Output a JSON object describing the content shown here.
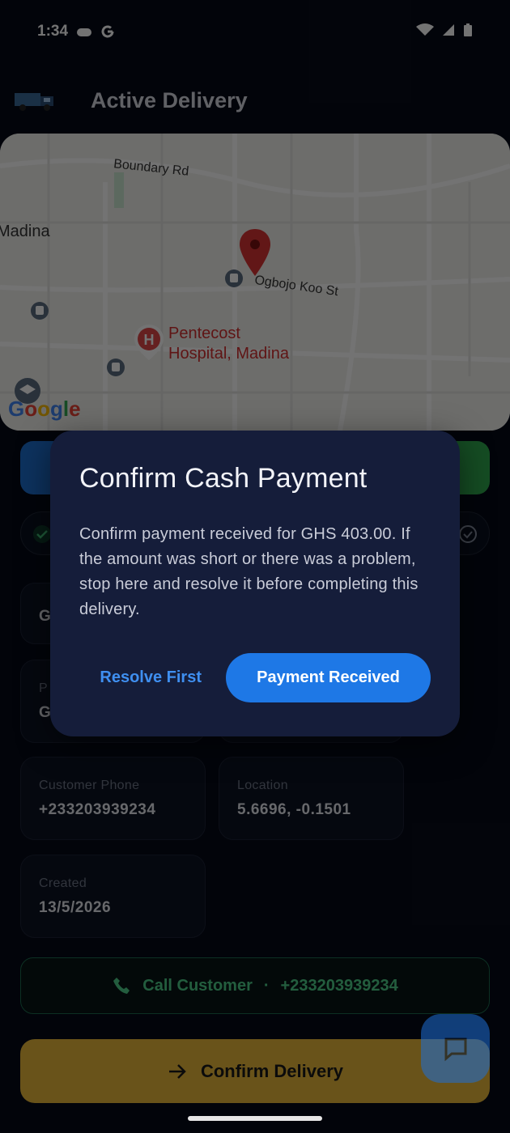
{
  "status_bar": {
    "time": "1:34"
  },
  "app_bar": {
    "title": "Active Delivery"
  },
  "map": {
    "road_boundary": "Boundary Rd",
    "area_madina": "Madina",
    "street_ogbojo": "Ogbojo Koo St",
    "poi_line1": "Pentecost",
    "poi_line2": "Hospital, Madina",
    "google_logo": "Google"
  },
  "cards": {
    "partial1_value": "G",
    "partial2_label": "P",
    "partial2_value": "G",
    "customer_phone_label": "Customer Phone",
    "customer_phone_value": "+233203939234",
    "location_label": "Location",
    "location_value": "5.6696, -0.1501",
    "created_label": "Created",
    "created_value": "13/5/2026"
  },
  "call_button": {
    "label": "Call Customer",
    "separator": "·",
    "phone": "+233203939234"
  },
  "confirm_button": {
    "label": "Confirm Delivery"
  },
  "dialog": {
    "title": "Confirm Cash Payment",
    "body": "Confirm payment received for GHS 403.00. If the amount was short or there was a problem, stop here and resolve it before completing this delivery.",
    "secondary_action": "Resolve First",
    "primary_action": "Payment Received"
  },
  "colors": {
    "background": "#060b18",
    "dialog": "#151d3a",
    "primary": "#1e78e6",
    "accent_green": "#4fcf8a",
    "confirm_yellow": "#e8b93a",
    "pin_red": "#d32f2f"
  }
}
